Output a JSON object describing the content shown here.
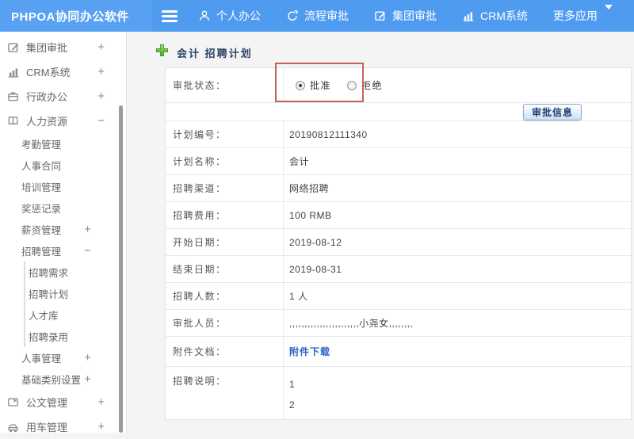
{
  "header": {
    "brand": "PHPOA协同办公软件",
    "nav": [
      {
        "label": "个人办公",
        "icon": "user-icon"
      },
      {
        "label": "流程审批",
        "icon": "process-approval-icon"
      },
      {
        "label": "集团审批",
        "icon": "edit-square-icon"
      },
      {
        "label": "CRM系统",
        "icon": "bar-chart-icon"
      },
      {
        "label": "更多应用",
        "icon": "",
        "trailing_icon": "caret-down-icon"
      }
    ]
  },
  "sidebar": {
    "items": [
      {
        "label": "集团审批",
        "level": 1,
        "icon": "edit-square-icon",
        "toggle": "+"
      },
      {
        "label": "CRM系统",
        "level": 1,
        "icon": "bar-chart-icon",
        "toggle": "+"
      },
      {
        "label": "行政办公",
        "level": 1,
        "icon": "briefcase-icon",
        "toggle": "+"
      },
      {
        "label": "人力资源",
        "level": 1,
        "icon": "book-icon",
        "toggle": "−"
      },
      {
        "label": "考勤管理",
        "level": 2,
        "toggle": ""
      },
      {
        "label": "人事合同",
        "level": 2,
        "toggle": ""
      },
      {
        "label": "培训管理",
        "level": 2,
        "toggle": ""
      },
      {
        "label": "奖惩记录",
        "level": 2,
        "toggle": ""
      },
      {
        "label": "薪资管理",
        "level": 2,
        "toggle": "+"
      },
      {
        "label": "招聘管理",
        "level": 2,
        "toggle": "−"
      },
      {
        "label": "招聘需求",
        "level": 3,
        "toggle": ""
      },
      {
        "label": "招聘计划",
        "level": 3,
        "toggle": ""
      },
      {
        "label": "人才库",
        "level": 3,
        "toggle": ""
      },
      {
        "label": "招聘录用",
        "level": 3,
        "toggle": ""
      },
      {
        "label": "人事管理",
        "level": 2,
        "toggle": "+"
      },
      {
        "label": "基础类别设置",
        "level": 2,
        "toggle": "+"
      },
      {
        "label": "公文管理",
        "level": 1,
        "icon": "folder-icon",
        "toggle": "+"
      },
      {
        "label": "用车管理",
        "level": 1,
        "icon": "car-icon",
        "toggle": "+"
      }
    ]
  },
  "main": {
    "title": "会计 招聘计划",
    "approval": {
      "label": "审批状态：",
      "options": [
        {
          "label": "批准",
          "checked": true
        },
        {
          "label": "拒绝",
          "checked": false
        }
      ]
    },
    "approve_info_button": "审批信息",
    "rows": [
      {
        "label": "计划编号：",
        "value": "20190812111340"
      },
      {
        "label": "计划名称：",
        "value": "会计"
      },
      {
        "label": "招聘渠道：",
        "value": "网络招聘"
      },
      {
        "label": "招聘费用：",
        "value": "100 RMB"
      },
      {
        "label": "开始日期：",
        "value": "2019-08-12"
      },
      {
        "label": "结束日期：",
        "value": "2019-08-31"
      },
      {
        "label": "招聘人数：",
        "value": "1 人"
      },
      {
        "label": "审批人员：",
        "value": ",,,,,,,,,,,,,,,,,,,,,,,小尧女,,,,,,,,"
      },
      {
        "label": "附件文档：",
        "value": "附件下载",
        "link": true
      },
      {
        "label": "招聘说明：",
        "lines": [
          "1",
          "2"
        ],
        "tall": true
      }
    ]
  },
  "colors": {
    "header_blue": "#4f9bf0",
    "brand_blue": "#58a1f2",
    "highlight_red": "#c5615c",
    "link_blue": "#2a66c8",
    "title_navy": "#2b4368",
    "plus_icon_green": "#4ea525"
  }
}
